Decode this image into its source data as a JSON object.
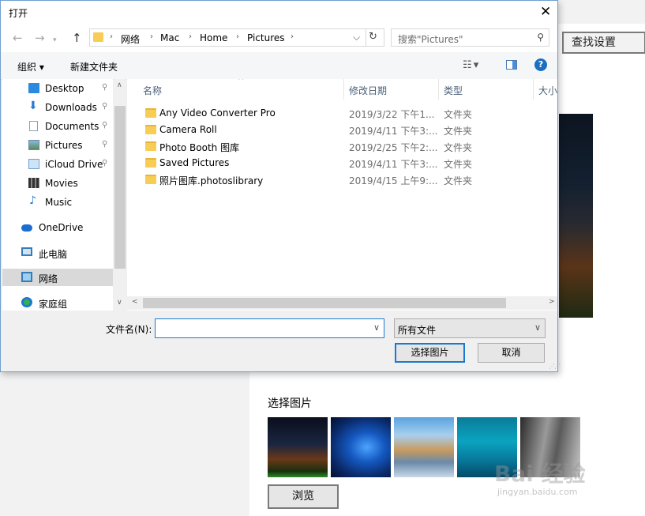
{
  "background": {
    "find_settings_button": "查找设置",
    "pictures_label": "选择图片",
    "browse_button": "浏览",
    "watermark": "Bai 经验",
    "watermark_url": "jingyan.baidu.com"
  },
  "dialog": {
    "title": "打开",
    "close_glyph": "✕",
    "nav": {
      "back_glyph": "←",
      "forward_glyph": "→",
      "up_glyph": "↑",
      "breadcrumb": [
        "网络",
        "Mac",
        "Home",
        "Pictures"
      ],
      "refresh_glyph": "↻",
      "search_placeholder": "搜索\"Pictures\""
    },
    "toolbar": {
      "organize": "组织 ▾",
      "new_folder": "新建文件夹",
      "help": "?"
    },
    "sidebar": {
      "items": [
        {
          "label": "Desktop",
          "icon": "desktop-icon",
          "pinned": true
        },
        {
          "label": "Downloads",
          "icon": "download-arrow-icon",
          "pinned": true
        },
        {
          "label": "Documents",
          "icon": "document-icon",
          "pinned": true
        },
        {
          "label": "Pictures",
          "icon": "pictures-icon",
          "pinned": true
        },
        {
          "label": "iCloud Drive",
          "icon": "cloud-icon",
          "pinned": true
        },
        {
          "label": "Movies",
          "icon": "film-icon",
          "pinned": false
        },
        {
          "label": "Music",
          "icon": "music-note-icon",
          "pinned": false
        },
        {
          "label": "OneDrive",
          "icon": "onedrive-icon",
          "pinned": false
        },
        {
          "label": "此电脑",
          "icon": "computer-icon",
          "pinned": false
        },
        {
          "label": "网络",
          "icon": "network-icon",
          "pinned": false,
          "selected": true
        },
        {
          "label": "家庭组",
          "icon": "homegroup-icon",
          "pinned": false
        }
      ],
      "pin_glyph": "📌"
    },
    "columns": {
      "name": "名称",
      "date": "修改日期",
      "type": "类型",
      "size": "大小"
    },
    "files": [
      {
        "name": "Any Video Converter Pro",
        "date": "2019/3/22 下午1...",
        "type": "文件夹"
      },
      {
        "name": "Camera Roll",
        "date": "2019/4/11 下午3:...",
        "type": "文件夹"
      },
      {
        "name": "Photo Booth 图库",
        "date": "2019/2/25 下午2:...",
        "type": "文件夹"
      },
      {
        "name": "Saved Pictures",
        "date": "2019/4/11 下午3:...",
        "type": "文件夹"
      },
      {
        "name": "照片图库.photoslibrary",
        "date": "2019/4/15 上午9:...",
        "type": "文件夹"
      }
    ],
    "footer": {
      "filename_label": "文件名(N):",
      "filename_value": "",
      "filetype_value": "所有文件",
      "open_button": "选择图片",
      "cancel_button": "取消"
    },
    "colors": {
      "accent": "#1a7ad0",
      "folder": "#f7cd55",
      "selected_row": "#d9d9d9"
    }
  }
}
